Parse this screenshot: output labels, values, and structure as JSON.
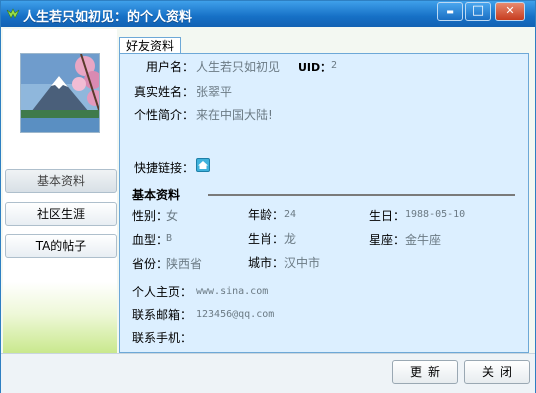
{
  "window": {
    "title": "人生若只如初见：的个人资料",
    "minimize": "▬",
    "maximize": "□",
    "close": "✕"
  },
  "sidebar": {
    "items": [
      {
        "label": "基本资料",
        "active": true
      },
      {
        "label": "社区生涯",
        "active": false
      },
      {
        "label": "TA的帖子",
        "active": false
      }
    ]
  },
  "tab": {
    "label": "好友资料"
  },
  "profile": {
    "username_label": "用户名：",
    "username": "人生若只如初见",
    "uid_label": "UID：",
    "uid": "2",
    "realname_label": "真实姓名：",
    "realname": "张翠平",
    "bio_label": "个性简介：",
    "bio": "来在中国大陆!",
    "shortcut_label": "快捷链接："
  },
  "basic": {
    "section_title": "基本资料",
    "gender_label": "性别：",
    "gender": "女",
    "age_label": "年龄：",
    "age": "24",
    "birthday_label": "生日：",
    "birthday": "1988-05-10",
    "blood_label": "血型：",
    "blood": "B",
    "zodiac_label": "生肖：",
    "zodiac": "龙",
    "star_label": "星座：",
    "star": "金牛座",
    "province_label": "省份：",
    "province": "陕西省",
    "city_label": "城市：",
    "city": "汉中市"
  },
  "contact": {
    "homepage_label": "个人主页：",
    "homepage": "www.sina.com",
    "email_label": "联系邮箱：",
    "email": "123456@qq.com",
    "phone_label": "联系手机：",
    "phone": ""
  },
  "actions": {
    "update": "更新",
    "close": "关闭"
  },
  "colors": {
    "titlebar": "#1670c6",
    "panel": "#dcefff",
    "value_text": "#6b7a84"
  }
}
